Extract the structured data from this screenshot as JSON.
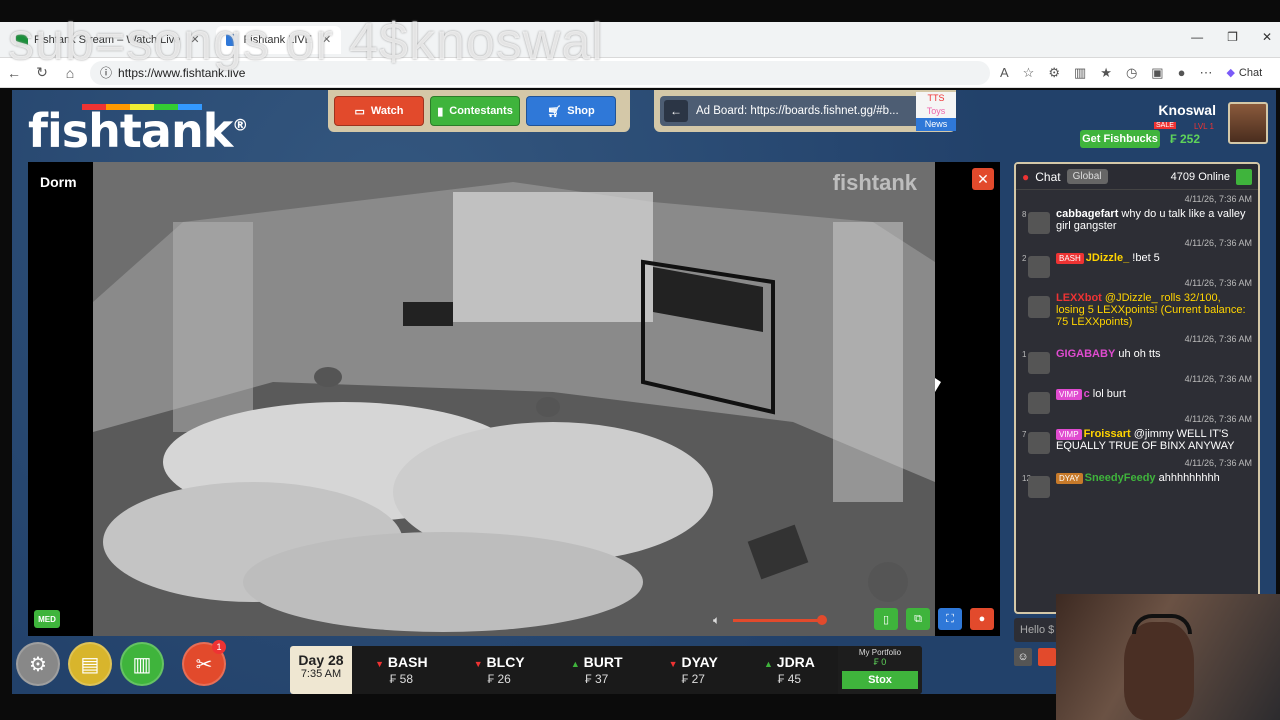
{
  "overlay": {
    "text": "sub=songs or 4$knoswal"
  },
  "browser": {
    "tabs": [
      {
        "label": "Fishtank Stream – Watch Live"
      },
      {
        "label": "Fishtank LIVE"
      }
    ],
    "url": "https://www.fishtank.live",
    "chat_label": "Chat"
  },
  "site": {
    "logo": "fishtank",
    "logo_mark": "®",
    "nav": {
      "watch": "Watch",
      "contestants": "Contestants",
      "shop": "Shop"
    },
    "adboard": {
      "text": "Ad Board: https://boards.fishnet.gg/#b...",
      "tabs": [
        "TTS",
        "Toys",
        "News"
      ]
    },
    "user": {
      "name": "Knoswal",
      "level": "LVL 1",
      "sale": "SALE",
      "get_fishbucks": "Get Fishbucks",
      "balance": "₣ 252"
    }
  },
  "player": {
    "room": "Dorm",
    "watermark": "fishtank",
    "quality": "MED",
    "volume_level": 0.82
  },
  "ticker": {
    "day": "Day 28",
    "time": "7:35 AM",
    "stocks": [
      {
        "sym": "BASH",
        "val": "₣ 58",
        "dir": "down"
      },
      {
        "sym": "BLCY",
        "val": "₣ 26",
        "dir": "down"
      },
      {
        "sym": "BURT",
        "val": "₣ 37",
        "dir": "up"
      },
      {
        "sym": "DYAY",
        "val": "₣ 27",
        "dir": "down"
      },
      {
        "sym": "JDRA",
        "val": "₣ 45",
        "dir": "up"
      }
    ],
    "portfolio_label": "My Portfolio",
    "portfolio_value": "₣ 0",
    "stox": "Stox"
  },
  "bottom_icons": {
    "badge_count": "1"
  },
  "chat": {
    "title": "Chat",
    "channel": "Global",
    "online": "4709 Online",
    "input_placeholder": "Hello $",
    "messages": [
      {
        "ts": "4/11/26, 7:36 AM",
        "lvl": "8",
        "tag": "",
        "name": "cabbagefart",
        "name_color": "#ffffff",
        "text": "why do u talk like a valley girl gangster",
        "text_color": "#ffffff"
      },
      {
        "ts": "4/11/26, 7:36 AM",
        "lvl": "2",
        "tag": "BASH",
        "tag_color": "#e33",
        "name": "JDizzle_",
        "name_color": "#ffd400",
        "text": "!bet 5",
        "text_color": "#ffffff"
      },
      {
        "ts": "4/11/26, 7:36 AM",
        "lvl": "",
        "tag": "",
        "name": "LEXXbot",
        "name_color": "#e33",
        "text": "@JDizzle_ rolls 32/100, losing 5 LEXXpoints! (Current balance: 75 LEXXpoints)",
        "text_color": "#ffd400"
      },
      {
        "ts": "4/11/26, 7:36 AM",
        "lvl": "1",
        "tag": "",
        "name": "GIGABABY",
        "name_color": "#e04bd0",
        "text": "uh oh tts",
        "text_color": "#ffffff"
      },
      {
        "ts": "4/11/26, 7:36 AM",
        "lvl": "",
        "tag": "VIMP",
        "tag_color": "#e04bd0",
        "name": "c",
        "name_color": "#e04bd0",
        "text": "lol burt",
        "text_color": "#ffffff"
      },
      {
        "ts": "4/11/26, 7:36 AM",
        "lvl": "7",
        "tag": "VIMP",
        "tag_color": "#e04bd0",
        "name": "Froissart",
        "name_color": "#ffd400",
        "text": "@jimmy WELL IT'S EQUALLY TRUE OF BINX ANYWAY",
        "text_color": "#ffffff"
      },
      {
        "ts": "4/11/26, 7:36 AM",
        "lvl": "12",
        "tag": "DYAY",
        "tag_color": "#c77a2a",
        "name": "SneedyFeedy",
        "name_color": "#3fb43c",
        "text": "ahhhhhhhhh",
        "text_color": "#ffffff"
      }
    ]
  }
}
